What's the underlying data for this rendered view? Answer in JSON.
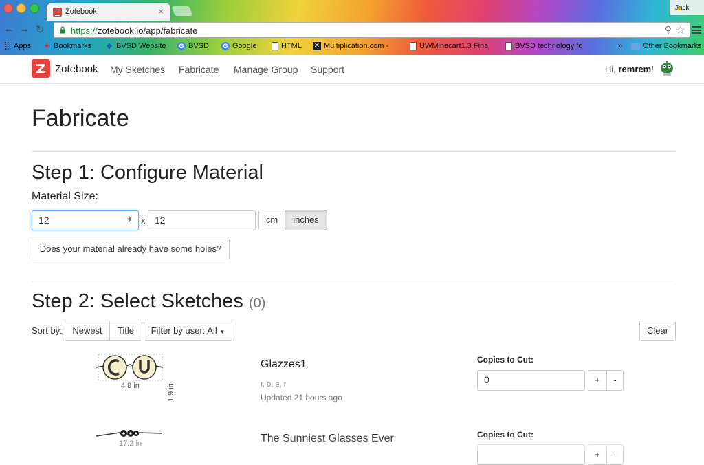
{
  "browser": {
    "tab_title": "Zotebook",
    "profile_name": "Jack",
    "url_scheme": "https://",
    "url_rest": "zotebook.io/app/fabricate",
    "bookmarks": [
      {
        "label": "Apps",
        "icon": "apps-grid-icon"
      },
      {
        "label": "Bookmarks",
        "icon": "star-icon"
      },
      {
        "label": "BVSD Website",
        "icon": "diamond-icon"
      },
      {
        "label": "BVSD",
        "icon": "google-icon"
      },
      {
        "label": "Google",
        "icon": "google-icon"
      },
      {
        "label": "HTML",
        "icon": "document-icon"
      },
      {
        "label": "Multiplication.com -",
        "icon": "x-icon"
      },
      {
        "label": "UWMinecart1.3 Fina",
        "icon": "document-icon"
      },
      {
        "label": "BVSD technology fo",
        "icon": "document-icon"
      },
      {
        "label": "»",
        "icon": "overflow-icon"
      },
      {
        "label": "Other Bookmarks",
        "icon": "folder-icon"
      }
    ]
  },
  "nav": {
    "brand": "Zotebook",
    "links": [
      "My Sketches",
      "Fabricate",
      "Manage Group",
      "Support"
    ],
    "greeting_prefix": "Hi, ",
    "username": "remrem",
    "greeting_suffix": "!"
  },
  "page": {
    "title": "Fabricate",
    "step1": {
      "title": "Step 1: Configure Material",
      "material_label": "Material Size:",
      "width": "12",
      "times": "x",
      "height": "12",
      "unit_cm": "cm",
      "unit_inches": "inches",
      "selected_unit": "inches",
      "holes_button": "Does your material already have some holes?"
    },
    "step2": {
      "title": "Step 2: Select Sketches",
      "count": "(0)",
      "sort_label": "Sort by:",
      "sort_newest": "Newest",
      "sort_title": "Title",
      "filter": "Filter by user: All",
      "clear": "Clear"
    },
    "sketches": [
      {
        "name": "Glazzes1",
        "author": "r, o, e, r",
        "updated": "Updated 21 hours ago",
        "width": "4.8 in",
        "height": "1.9 in",
        "copies_label": "Copies to Cut:",
        "copies": "0"
      },
      {
        "name": "The Sunniest Glasses Ever",
        "width": "17.2 in",
        "copies_label": "Copies to Cut:"
      }
    ]
  },
  "colors": {
    "brand": "#e2433b",
    "https_green": "#1a8a2e",
    "focus": "#66afe9"
  }
}
